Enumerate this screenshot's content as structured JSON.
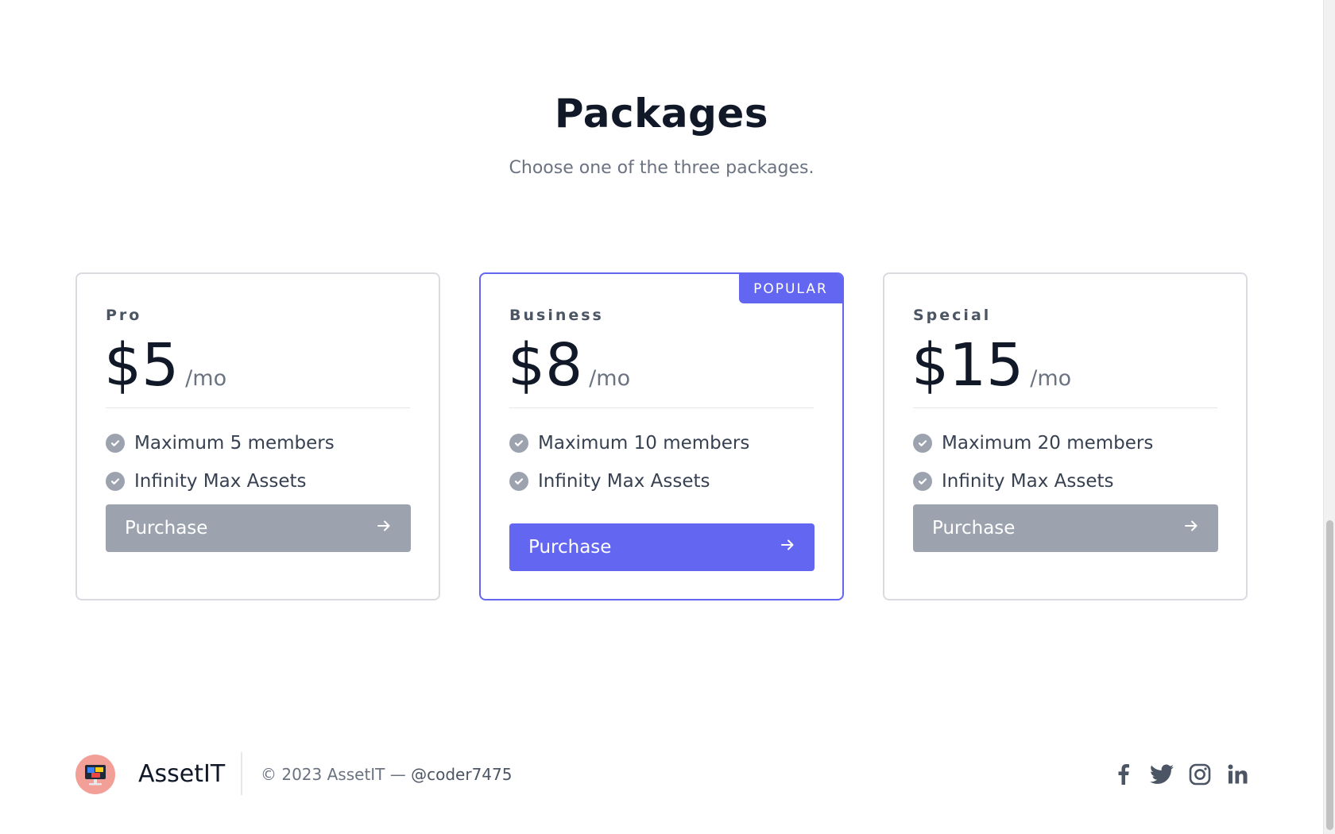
{
  "header": {
    "title": "Packages",
    "subtitle": "Choose one of the three packages."
  },
  "plans": [
    {
      "name": "Pro",
      "price": "$5",
      "period": "/mo",
      "features": [
        "Maximum 5 members",
        "Infinity Max Assets"
      ],
      "button_label": "Purchase",
      "featured": false
    },
    {
      "name": "Business",
      "price": "$8",
      "period": "/mo",
      "badge": "POPULAR",
      "features": [
        "Maximum 10 members",
        "Infinity Max Assets"
      ],
      "button_label": "Purchase",
      "featured": true
    },
    {
      "name": "Special",
      "price": "$15",
      "period": "/mo",
      "features": [
        "Maximum 20 members",
        "Infinity Max Assets"
      ],
      "button_label": "Purchase",
      "featured": false
    }
  ],
  "footer": {
    "brand": "AssetIT",
    "copyright": "© 2023 AssetIT — ",
    "handle": "@coder7475",
    "social_icons": [
      "facebook-icon",
      "twitter-icon",
      "instagram-icon",
      "linkedin-icon"
    ]
  },
  "colors": {
    "accent": "#6366f1",
    "muted_button": "#9ca3af",
    "logo_bg": "#f29f97"
  }
}
